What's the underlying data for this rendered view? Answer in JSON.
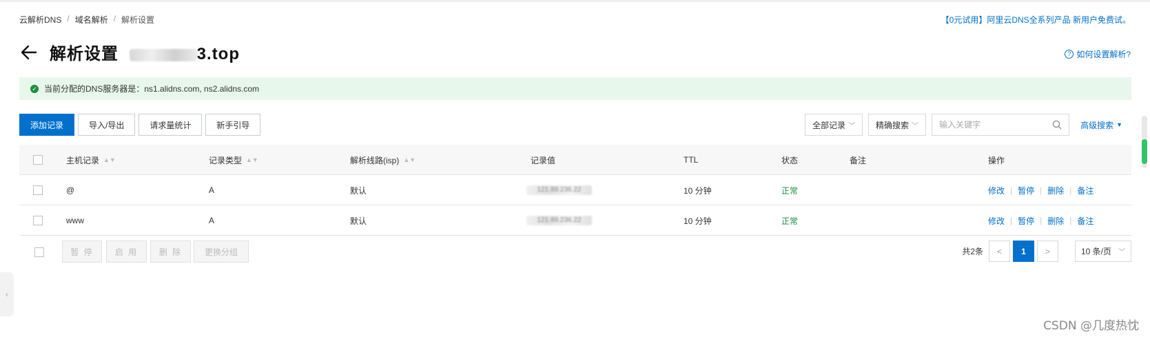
{
  "breadcrumb": [
    "云解析DNS",
    "域名解析",
    "解析设置"
  ],
  "promo_text": "【0元试用】阿里云DNS全系列产品 新用户免费试。",
  "page": {
    "title": "解析设置",
    "domain_suffix": "3.top",
    "help_link": "如何设置解析?"
  },
  "notice": {
    "text": "当前分配的DNS服务器是：ns1.alidns.com, ns2.alidns.com"
  },
  "toolbar": {
    "add_record": "添加记录",
    "import_export": "导入/导出",
    "request_stats": "请求量统计",
    "guide": "新手引导"
  },
  "filters": {
    "all_records": "全部记录",
    "exact_search": "精确搜索",
    "search_placeholder": "输入关键字",
    "advanced_search": "高级搜索"
  },
  "table": {
    "columns": [
      "主机记录",
      "记录类型",
      "解析线路(isp)",
      "记录值",
      "TTL",
      "状态",
      "备注",
      "操作"
    ],
    "rows": [
      {
        "host": "@",
        "type": "A",
        "line": "默认",
        "value": "121.89.236.22",
        "ttl": "10 分钟",
        "status": "正常",
        "remark": ""
      },
      {
        "host": "www",
        "type": "A",
        "line": "默认",
        "value": "121.89.236.22",
        "ttl": "10 分钟",
        "status": "正常",
        "remark": ""
      }
    ],
    "ops": [
      "修改",
      "暂停",
      "删除",
      "备注"
    ]
  },
  "batch": {
    "pause": "暂 停",
    "enable": "启 用",
    "delete": "删 除",
    "change_group": "更换分组"
  },
  "pagination": {
    "total": "共2条",
    "current": "1",
    "page_size": "10 条/页"
  },
  "watermark": "CSDN @几度热忱",
  "colors": {
    "primary": "#0070cc",
    "success": "#1e8e3e",
    "notice_bg": "#e8f7ec"
  }
}
